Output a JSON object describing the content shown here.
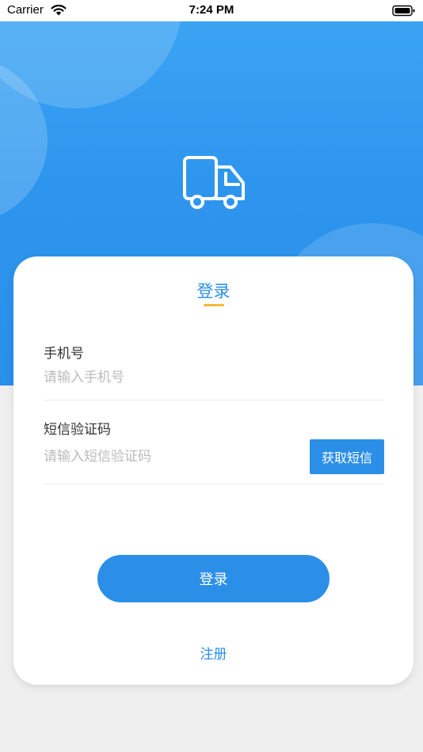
{
  "status_bar": {
    "carrier": "Carrier",
    "time": "7:24 PM"
  },
  "header": {
    "icon": "truck-icon",
    "gradient_colors": [
      "#3aa4f2",
      "#2a8fe9"
    ]
  },
  "login_card": {
    "title": "登录",
    "phone_field": {
      "label": "手机号",
      "placeholder": "请输入手机号",
      "value": ""
    },
    "code_field": {
      "label": "短信验证码",
      "placeholder": "请输入短信验证码",
      "value": ""
    },
    "get_sms_button": "获取短信",
    "login_button": "登录",
    "register_link": "注册"
  },
  "colors": {
    "accent": "#2b8fe8",
    "underline": "#f5b83d",
    "background": "#efefef"
  }
}
